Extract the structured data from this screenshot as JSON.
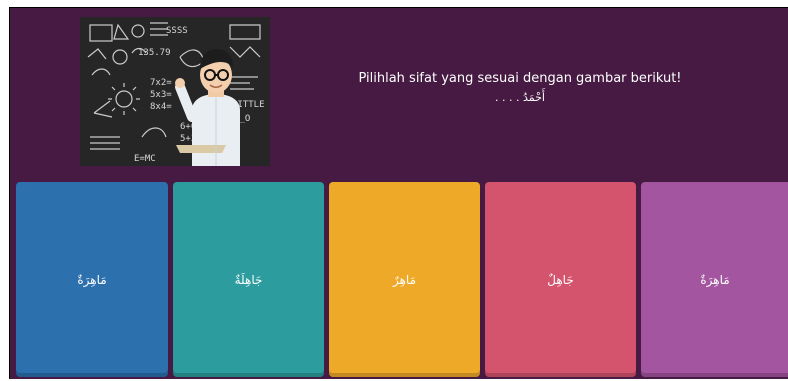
{
  "question": {
    "text": "Pilihlah sifat yang sesuai dengan gambar berikut!",
    "arabic_line": "أَحْمَدُ . . . .",
    "image_icon": "boy-with-chalkboard-image"
  },
  "options": [
    {
      "label": "مَاهِرَةٌ",
      "color": "#2d70ae"
    },
    {
      "label": "جَاهِلَةٌ",
      "color": "#2d9c9e"
    },
    {
      "label": "مَاهِرٌ",
      "color": "#efa929"
    },
    {
      "label": "جَاهِلٌ",
      "color": "#d5546d"
    },
    {
      "label": "مَاهِرَةٌ",
      "color": "#a4559f"
    }
  ],
  "colors": {
    "background": "#461a42"
  }
}
